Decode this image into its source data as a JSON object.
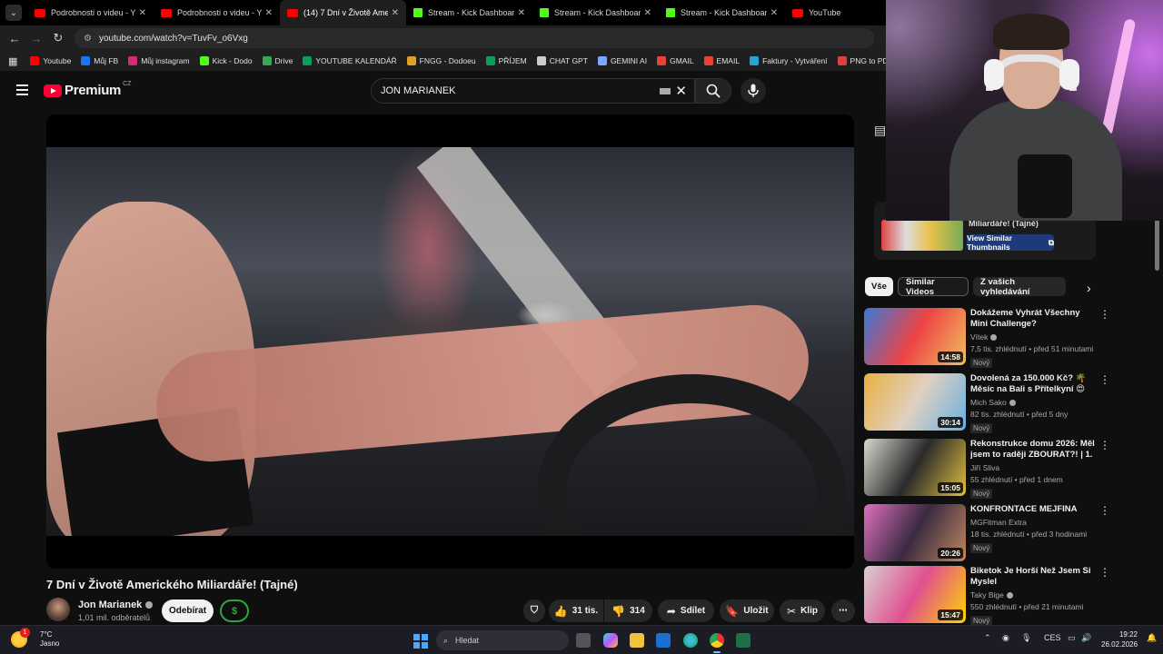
{
  "browser": {
    "tabs": [
      {
        "title": "Podrobnosti o videu - You",
        "icon": "youtube-studio-icon",
        "active": false
      },
      {
        "title": "Podrobnosti o videu - You",
        "icon": "youtube-studio-icon",
        "active": false
      },
      {
        "title": "(14) 7 Dní v Životě Americk",
        "icon": "youtube-icon",
        "active": true
      },
      {
        "title": "Stream - Kick Dashboard",
        "icon": "kick-icon",
        "active": false
      },
      {
        "title": "Stream - Kick Dashboard",
        "icon": "kick-icon",
        "active": false
      },
      {
        "title": "Stream - Kick Dashboard",
        "icon": "kick-icon",
        "active": false
      },
      {
        "title": "YouTube",
        "icon": "youtube-icon",
        "active": false
      }
    ],
    "url": "youtube.com/watch?v=TuvFv_o6Vxg",
    "bookmarks": [
      {
        "label": "Youtube",
        "color": "#ff0000"
      },
      {
        "label": "Můj FB",
        "color": "#1877f2"
      },
      {
        "label": "Můj instagram",
        "color": "#d62976"
      },
      {
        "label": "Kick - Dodo",
        "color": "#53fc18"
      },
      {
        "label": "Drive",
        "color": "#34a853"
      },
      {
        "label": "YOUTUBE KALENDÁŘ",
        "color": "#0f9d58"
      },
      {
        "label": "FNGG - Dodoeu",
        "color": "#e0a020"
      },
      {
        "label": "PŘÍJEM",
        "color": "#0f9d58"
      },
      {
        "label": "CHAT GPT",
        "color": "#cccccc"
      },
      {
        "label": "GEMINI AI",
        "color": "#7aa7ff"
      },
      {
        "label": "GMAIL",
        "color": "#ea4335"
      },
      {
        "label": "EMAIL",
        "color": "#ea4335"
      },
      {
        "label": "Faktury - Vytváření",
        "color": "#2aa0d8"
      },
      {
        "label": "PNG to PDF",
        "color": "#e04040"
      }
    ]
  },
  "youtube": {
    "logo_text": "Premium",
    "region": "CZ",
    "search_value": "JON MARIANEK"
  },
  "video": {
    "title": "7 Dní v Životě Amerického Miliardáře! (Tajné)",
    "channel": "Jon Marianek",
    "subscribers": "1,01 mil. odběratelů",
    "subscribe_label": "Odebírat",
    "donate_label": "$",
    "likes": "31 tis.",
    "dislikes": "314",
    "share_label": "Sdílet",
    "save_label": "Uložit",
    "clip_label": "Klip"
  },
  "sidebar": {
    "thumb_card_title": "Miliardáře! (Tajné)",
    "thumb_card_button": "View Similar Thumbnails",
    "chips": [
      "Vše",
      "Similar Videos",
      "Z vašich vyhledávání"
    ],
    "recommendations": [
      {
        "title": "Dokážeme Vyhrát Všechny Mini Challenge?",
        "channel": "Vítek",
        "verified": true,
        "meta": "7,5 tis. zhlédnutí • před 51 minutami",
        "badge": "Nový",
        "duration": "14:58",
        "thumb_colors": [
          "#3a78d8",
          "#e44",
          "#f0c060"
        ]
      },
      {
        "title": "Dovolená za 150.000 Kč? 🌴 Měsíc na Bali s Přítelkyní 😍",
        "channel": "Mich Sako",
        "verified": true,
        "meta": "82 tis. zhlédnutí • před 5 dny",
        "badge": "Nový",
        "duration": "30:14",
        "thumb_colors": [
          "#e8b040",
          "#e0d0c0",
          "#6ab0e0"
        ]
      },
      {
        "title": "Rekonstrukce domu 2026: Měl jsem to raději ZBOURAT?! | 1. ...",
        "channel": "Jiří Sliva",
        "verified": false,
        "meta": "55 zhlédnutí • před 1 dnem",
        "badge": "Nový",
        "duration": "15:05",
        "thumb_colors": [
          "#d8d8d0",
          "#2a2a2a",
          "#e0c040"
        ]
      },
      {
        "title": "KONFRONTACE MEJFINA",
        "channel": "MGFitman Extra",
        "verified": false,
        "meta": "18 tis. zhlédnutí • před 3 hodinami",
        "badge": "Nový",
        "duration": "20:26",
        "thumb_colors": [
          "#e070c0",
          "#3a2a40",
          "#c08860"
        ]
      },
      {
        "title": "Biketok Je Horší Než Jsem Si Myslel",
        "channel": "Taky Bige",
        "verified": true,
        "meta": "550 zhlédnutí • před 21 minutami",
        "badge": "Nový",
        "duration": "15:47",
        "thumb_colors": [
          "#d8d0d0",
          "#e05090",
          "#ffd400"
        ]
      }
    ]
  },
  "taskbar": {
    "temp": "7°C",
    "weather": "Jasno",
    "notif_count": "1",
    "search_placeholder": "Hledat",
    "lang": "CES",
    "time": "19:22",
    "date": "26.02.2026"
  }
}
